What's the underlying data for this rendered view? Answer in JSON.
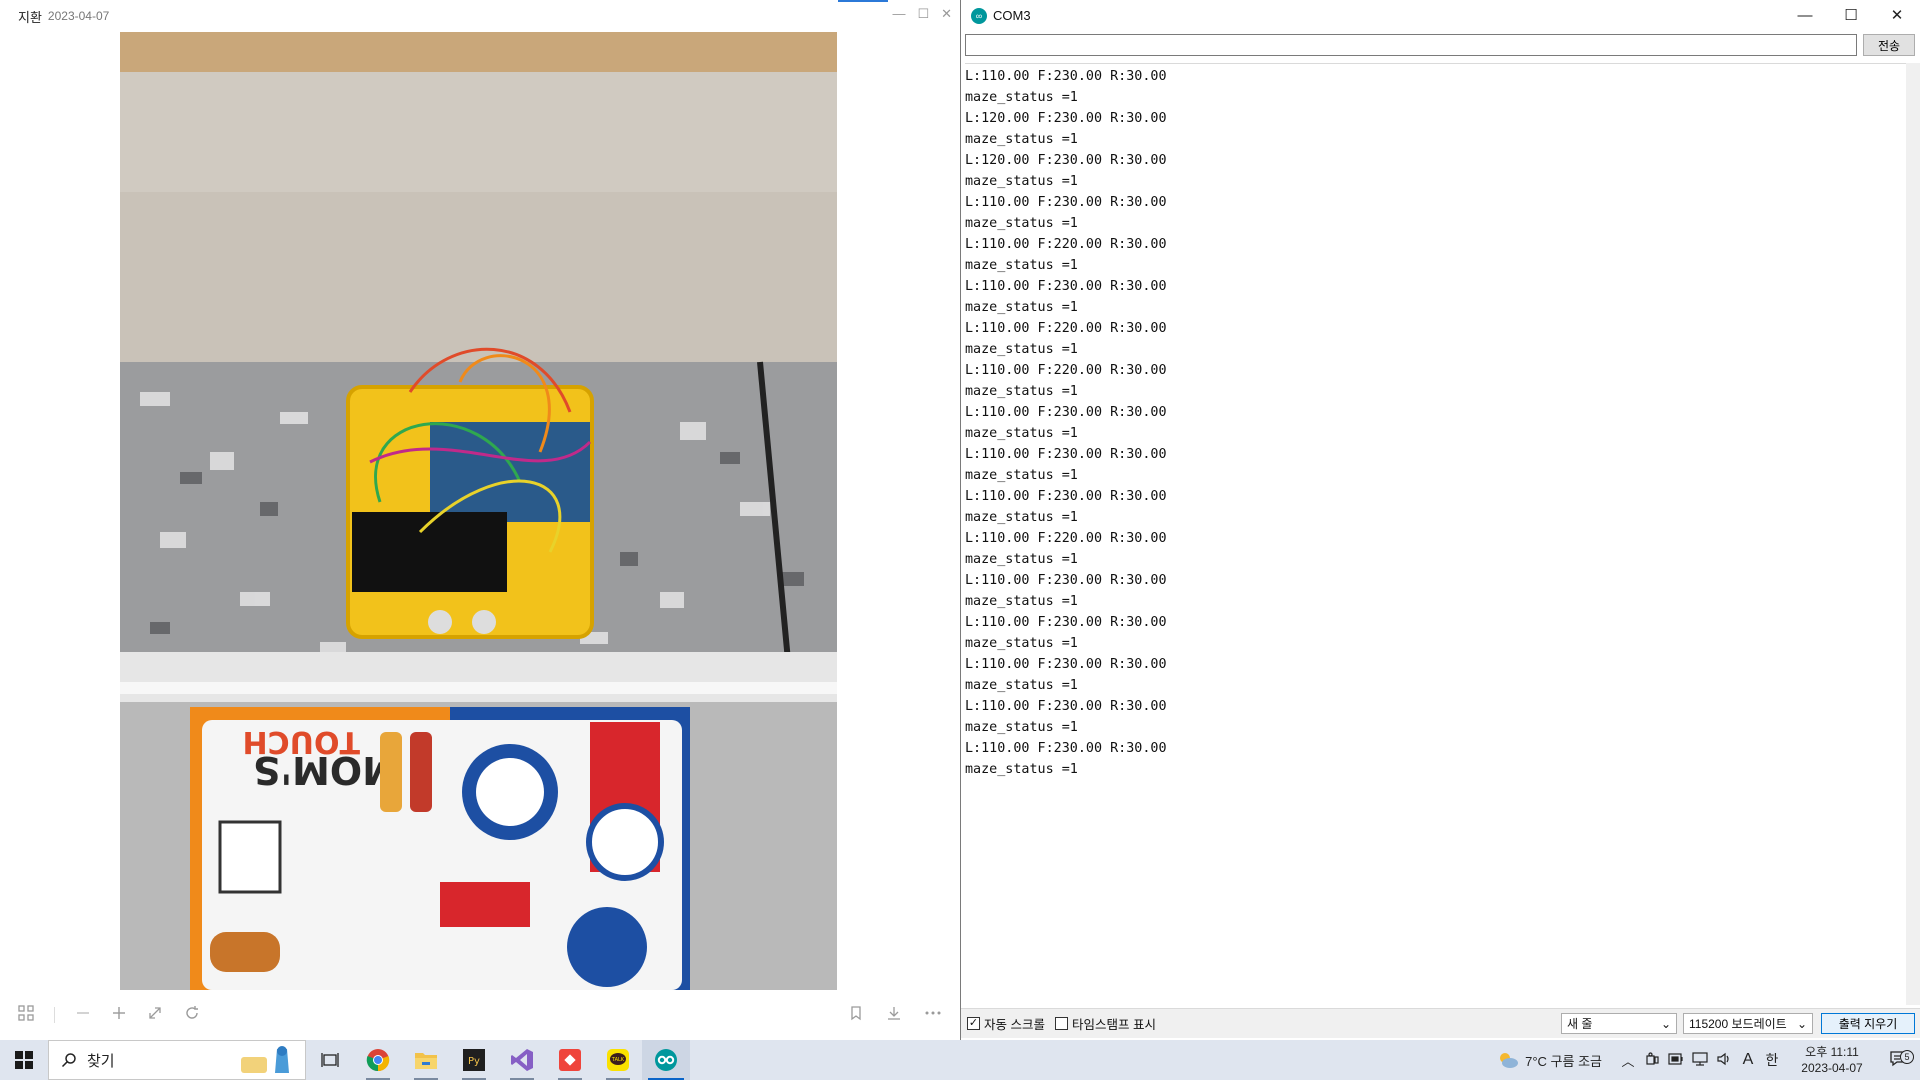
{
  "viewer": {
    "title": "지환",
    "date": "2023-04-07",
    "controls": [
      "—",
      "☐",
      "✕"
    ],
    "toolbar_left": [
      "grid-icon",
      "zoom-out-icon",
      "zoom-in-icon",
      "fit-icon",
      "rotate-icon"
    ],
    "toolbar_right": [
      "bookmark-icon",
      "download-icon",
      "more-icon"
    ]
  },
  "serial": {
    "title": "COM3",
    "send_input_value": "",
    "send_label": "전송",
    "output_lines": [
      "L:110.00 F:230.00 R:30.00",
      "maze_status =1",
      "L:120.00 F:230.00 R:30.00",
      "maze_status =1",
      "L:120.00 F:230.00 R:30.00",
      "maze_status =1",
      "L:110.00 F:230.00 R:30.00",
      "maze_status =1",
      "L:110.00 F:220.00 R:30.00",
      "maze_status =1",
      "L:110.00 F:230.00 R:30.00",
      "maze_status =1",
      "L:110.00 F:220.00 R:30.00",
      "maze_status =1",
      "L:110.00 F:220.00 R:30.00",
      "maze_status =1",
      "L:110.00 F:230.00 R:30.00",
      "maze_status =1",
      "L:110.00 F:230.00 R:30.00",
      "maze_status =1",
      "L:110.00 F:230.00 R:30.00",
      "maze_status =1",
      "L:110.00 F:220.00 R:30.00",
      "maze_status =1",
      "L:110.00 F:230.00 R:30.00",
      "maze_status =1",
      "L:110.00 F:230.00 R:30.00",
      "maze_status =1",
      "L:110.00 F:230.00 R:30.00",
      "maze_status =1",
      "L:110.00 F:230.00 R:30.00",
      "maze_status =1",
      "L:110.00 F:230.00 R:30.00",
      "maze_status =1"
    ],
    "autoscroll_label": "자동 스크롤",
    "autoscroll_checked": true,
    "timestamp_label": "타임스탬프 표시",
    "timestamp_checked": false,
    "line_ending": "새 줄",
    "baud_rate": "115200 보드레이트",
    "clear_label": "출력 지우기"
  },
  "taskbar": {
    "search_placeholder": "찾기",
    "apps": [
      "chrome-icon",
      "file-explorer-icon",
      "python-app-icon",
      "visual-studio-icon",
      "anydesk-icon",
      "kakaotalk-icon",
      "arduino-icon"
    ],
    "weather": "7°C 구름 조금",
    "ime_label": "A",
    "lang_label": "한",
    "time": "오후 11:11",
    "date": "2023-04-07",
    "notification_count": "5"
  },
  "colors": {
    "accent": "#0078d7",
    "arduino": "#00979c"
  }
}
